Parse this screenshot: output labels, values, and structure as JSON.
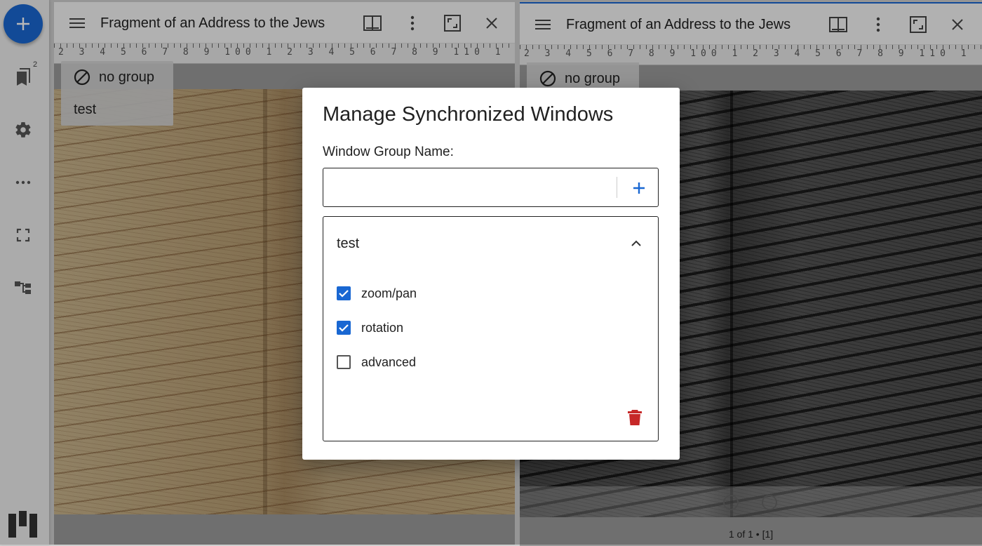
{
  "app": {
    "add_resource_label": "+",
    "catalog_count": "2"
  },
  "windows": [
    {
      "title": "Fragment of an Address to the Jews",
      "group_menu": [
        "no group",
        "test"
      ]
    },
    {
      "title": "Fragment of an Address to the Jews",
      "group_chip": "no group",
      "pager": "1 of 1 • [1]"
    }
  ],
  "ruler": {
    "text": "2 3 4 5 6 7 8 9 100 1 2 3 4 5 6 7 8 9 110 1 2 3 4 5 6 7 8"
  },
  "dialog": {
    "title": "Manage Synchronized Windows",
    "field_label": "Window Group Name:",
    "name_value": "",
    "group": {
      "name": "test",
      "options": [
        {
          "label": "zoom/pan",
          "checked": true
        },
        {
          "label": "rotation",
          "checked": true
        },
        {
          "label": "advanced",
          "checked": false
        }
      ]
    }
  },
  "colors": {
    "accent": "#1967d2",
    "danger": "#c62828"
  }
}
